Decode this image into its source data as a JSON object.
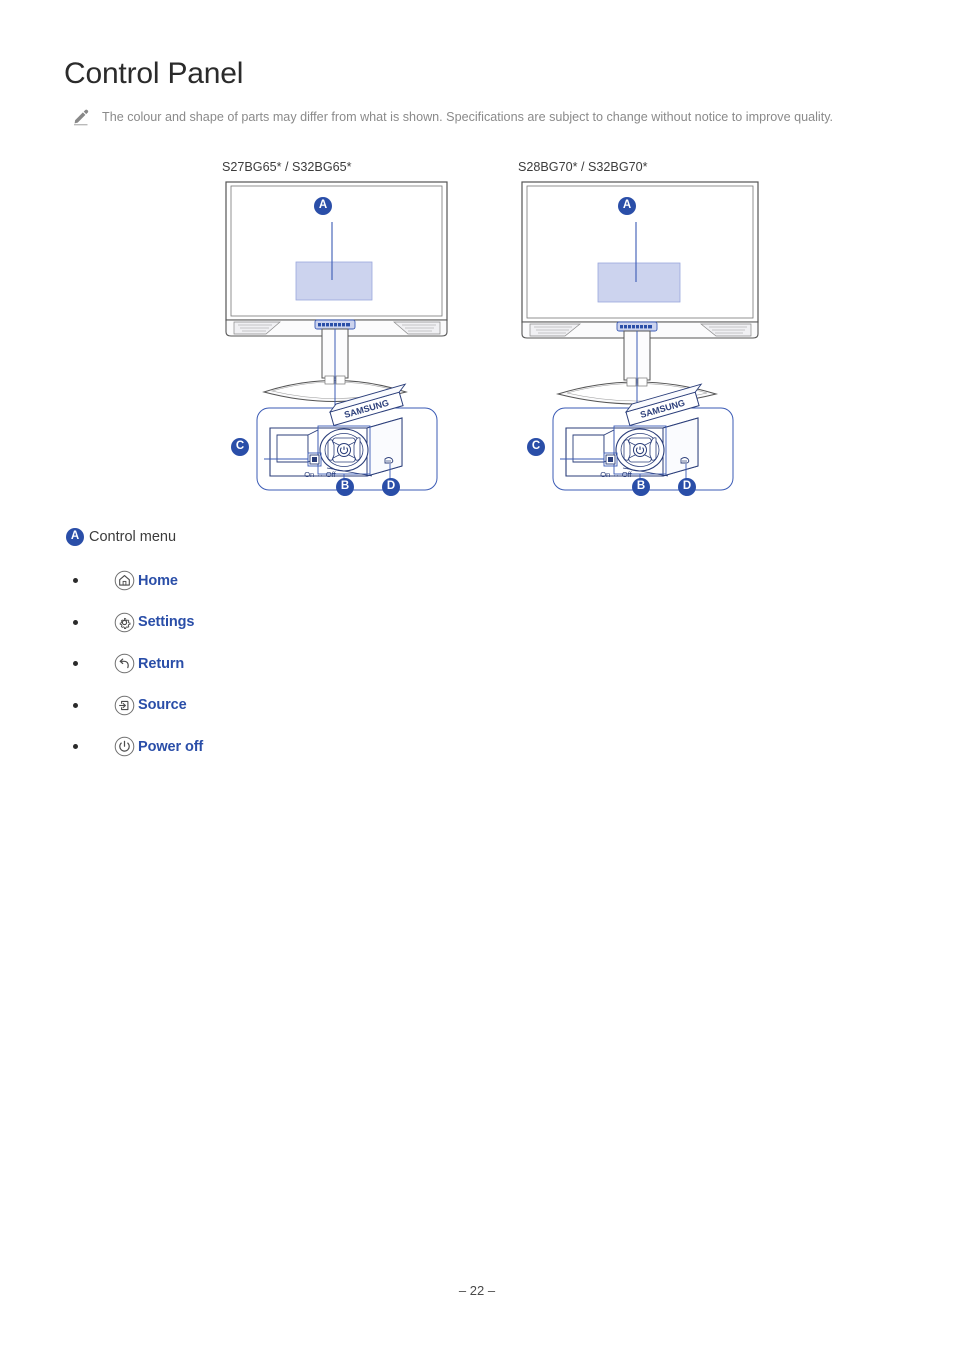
{
  "document": {
    "title": "Control Panel",
    "page_number": "– 22 –"
  },
  "note": {
    "icon": "pencil-icon",
    "text": "The colour and shape of parts may differ from what is shown. Specifications are subject to change without notice to improve quality."
  },
  "figures": [
    {
      "caption": "S27BG65* / S32BG65*",
      "screen_badge": "A",
      "detail_badges": {
        "left": "C",
        "bottom_left": "B",
        "bottom_right": "D"
      },
      "brand_label": "SAMSUNG",
      "switch_label": "On ↔ Off"
    },
    {
      "caption": "S28BG70* / S32BG70*",
      "screen_badge": "A",
      "detail_badges": {
        "left": "C",
        "bottom_left": "B",
        "bottom_right": "D"
      },
      "brand_label": "SAMSUNG",
      "switch_label": "On ↔ Off"
    }
  ],
  "control_menu": {
    "badge": "A",
    "heading": "Control menu",
    "items": [
      {
        "icon": "home-icon",
        "label": "Home"
      },
      {
        "icon": "settings-icon",
        "label": "Settings"
      },
      {
        "icon": "return-icon",
        "label": "Return"
      },
      {
        "icon": "source-icon",
        "label": "Source"
      },
      {
        "icon": "power-off-icon",
        "label": "Power off"
      }
    ]
  },
  "colors": {
    "accent_blue": "#2a4ea8",
    "line_blue": "#3b5bb5",
    "osd_fill": "#ccd3ee",
    "note_grey": "#8a8a8a",
    "text_dark": "#2b2b2b"
  }
}
